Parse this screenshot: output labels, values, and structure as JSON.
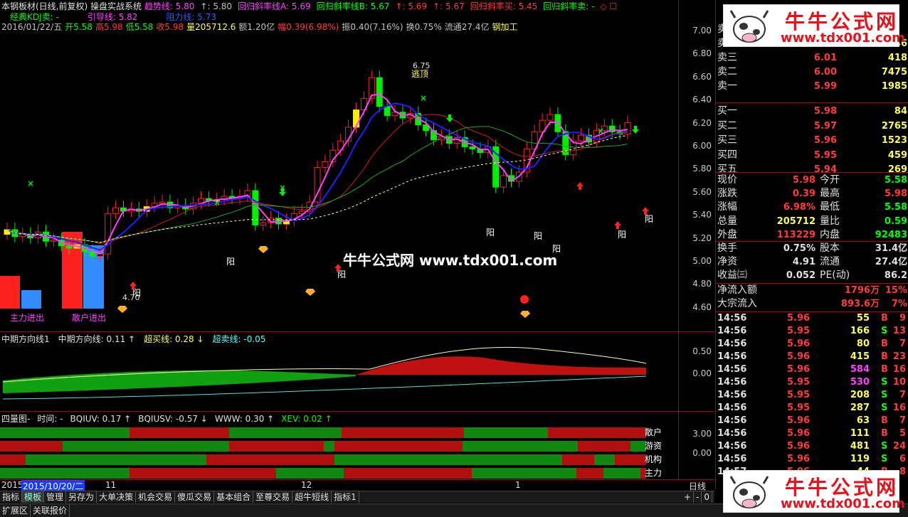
{
  "header": {
    "title": "本钢板材(日线,前复权) 操盘实战系统",
    "items": [
      {
        "label": "趋势线: 5.80",
        "color": "#ff40ff"
      },
      {
        "label": "↑: 5.80",
        "color": "#c0c0c0"
      },
      {
        "label": "回归斜率线A: 5.69",
        "color": "#ff40ff"
      },
      {
        "label": "回归斜率线B: 5.67",
        "color": "#00ff00"
      },
      {
        "label": "↑: 5.69",
        "color": "#ff3b3b"
      },
      {
        "label": "↑: 5.67",
        "color": "#ff3b3b"
      },
      {
        "label": "回归斜率买: 5.45",
        "color": "#ff3b3b"
      },
      {
        "label": "回归斜率卖: -",
        "color": "#00ff00"
      },
      {
        "label": "◇ ☐",
        "color": "#ff3b3b"
      }
    ],
    "line2": [
      {
        "label": "经典KDJ卖: -",
        "color": "#00ff00"
      },
      {
        "label": "引导线: 5.82",
        "color": "#ff40ff"
      },
      {
        "label": "阻力线: 5.73",
        "color": "#2c5cff"
      }
    ],
    "line3": [
      {
        "label": "2016/01/22/五",
        "color": "#c0c0c0"
      },
      {
        "label": "开5.58",
        "color": "#00ff00"
      },
      {
        "label": "高5.98",
        "color": "#ff3b3b"
      },
      {
        "label": "低5.58",
        "color": "#00ff00"
      },
      {
        "label": "收5.98",
        "color": "#ff3b3b"
      },
      {
        "label": "量205712.6",
        "color": "#ffff55"
      },
      {
        "label": "额1.20亿",
        "color": "#c0c0c0"
      },
      {
        "label": "幅0.39(6.98%)",
        "color": "#ff3b3b"
      },
      {
        "label": "振0.40(7.16%)",
        "color": "#c0c0c0"
      },
      {
        "label": "换0.75%",
        "color": "#c0c0c0"
      },
      {
        "label": "流通27.4亿",
        "color": "#c0c0c0"
      },
      {
        "label": "钢加工",
        "color": "#ffff55"
      }
    ]
  },
  "main_chart": {
    "price_ticks": [
      "7.00",
      "6.80",
      "6.60",
      "6.40",
      "6.20",
      "6.00",
      "5.80",
      "5.60",
      "5.40",
      "5.20",
      "5.00",
      "4.80",
      "4.60"
    ],
    "high_label": "6.75",
    "escape_label": "逃顶",
    "low_label": "4.70",
    "sun_label": "阳",
    "bar_labels": [
      "主力进出",
      "散户进出"
    ],
    "watermark": "牛牛公式网 www.tdx001.com"
  },
  "pane2": {
    "items": [
      {
        "label": "中期方向线1",
        "color": "#e0e0e0"
      },
      {
        "label": "中期方向线: 0.11 ↑",
        "color": "#e0e0e0"
      },
      {
        "label": "超买线: 0.28 ↓",
        "color": "#ffff55"
      },
      {
        "label": "超卖线: -0.05",
        "color": "#55ffff"
      }
    ],
    "ticks": [
      "0.50",
      "0.00"
    ]
  },
  "pane3": {
    "items": [
      {
        "label": "四量图-",
        "color": "#e0e0e0"
      },
      {
        "label": "时间: -",
        "color": "#e0e0e0"
      },
      {
        "label": "BQIUV: 0.17 ↑",
        "color": "#e0e0e0"
      },
      {
        "label": "BQIUSV: -0.57 ↓",
        "color": "#e0e0e0"
      },
      {
        "label": "WWW: 0.30 ↑",
        "color": "#e0e0e0"
      },
      {
        "label": "XEV: 0.02 ↑",
        "color": "#00ff00"
      }
    ],
    "ticks": [
      "3.00",
      "0.00"
    ],
    "row_labels": [
      "散户",
      "游资",
      "机构",
      "主力"
    ]
  },
  "date_axis": {
    "start": "2015",
    "selected": "2015/10/20/二",
    "m11": "11",
    "m12": "12",
    "m1": "1"
  },
  "toolbar": {
    "tabs": [
      "指标",
      "模板",
      "管理",
      "另存为",
      "大单决策",
      "机会交易",
      "傻瓜交易",
      "基本组合",
      "至尊交易",
      "超牛短线",
      "指标1"
    ],
    "right": [
      "日线",
      "+",
      "-",
      "0"
    ]
  },
  "bottom_tabs": [
    "扩展区",
    "关联报价"
  ],
  "brand": {
    "cn": "牛牛公式网",
    "url": "www.tdx001.com"
  },
  "quote": {
    "asks": [
      {
        "label": "卖五",
        "price": "",
        "vol": ""
      },
      {
        "label": "卖四",
        "price": "6.02",
        "vol": "646"
      },
      {
        "label": "卖三",
        "price": "6.01",
        "vol": "418"
      },
      {
        "label": "卖二",
        "price": "6.00",
        "vol": "7475"
      },
      {
        "label": "卖一",
        "price": "5.99",
        "vol": "1985"
      }
    ],
    "bids": [
      {
        "label": "买一",
        "price": "5.98",
        "vol": "84"
      },
      {
        "label": "买二",
        "price": "5.97",
        "vol": "2765"
      },
      {
        "label": "买三",
        "price": "5.96",
        "vol": "1523"
      },
      {
        "label": "买四",
        "price": "5.95",
        "vol": "459"
      },
      {
        "label": "买五",
        "price": "5.94",
        "vol": "269"
      }
    ],
    "stats": [
      {
        "l1": "现价",
        "v1": "5.98",
        "c1": "#ff3b3b",
        "l2": "今开",
        "v2": "5.58",
        "c2": "#00ff00"
      },
      {
        "l1": "涨跌",
        "v1": "0.39",
        "c1": "#ff3b3b",
        "l2": "最高",
        "v2": "5.98",
        "c2": "#ff3b3b"
      },
      {
        "l1": "涨幅",
        "v1": "6.98%",
        "c1": "#ff3b3b",
        "l2": "最低",
        "v2": "5.58",
        "c2": "#00ff00"
      },
      {
        "l1": "总量",
        "v1": "205712",
        "c1": "#ffff55",
        "l2": "量比",
        "v2": "0.59",
        "c2": "#00ff00"
      },
      {
        "l1": "外盘",
        "v1": "113229",
        "c1": "#ff3b3b",
        "l2": "内盘",
        "v2": "92483",
        "c2": "#00ff00"
      }
    ],
    "stats2": [
      {
        "l1": "换手",
        "v1": "0.75%",
        "c1": "#e0e0e0",
        "l2": "股本",
        "v2": "31.4亿",
        "c2": "#e0e0e0"
      },
      {
        "l1": "净资",
        "v1": "4.91",
        "c1": "#e0e0e0",
        "l2": "流通",
        "v2": "27.4亿",
        "c2": "#e0e0e0"
      },
      {
        "l1": "收益㈢",
        "v1": "0.052",
        "c1": "#e0e0e0",
        "l2": "PE(动)",
        "v2": "86.2",
        "c2": "#e0e0e0"
      }
    ],
    "flows": [
      {
        "label": "净流入额",
        "val": "1796万",
        "pct": "15%"
      },
      {
        "label": "大宗流入",
        "val": "893.6万",
        "pct": "7%"
      }
    ],
    "ticks": [
      {
        "time": "14:56",
        "price": "5.96",
        "vol": "55",
        "side": "B",
        "n": "9",
        "vc": "#ffff55"
      },
      {
        "time": "14:56",
        "price": "5.95",
        "vol": "166",
        "side": "S",
        "n": "13",
        "vc": "#ffff55"
      },
      {
        "time": "14:56",
        "price": "5.96",
        "vol": "80",
        "side": "B",
        "n": "7",
        "vc": "#ffff55"
      },
      {
        "time": "14:56",
        "price": "5.96",
        "vol": "415",
        "side": "B",
        "n": "23",
        "vc": "#ffff55"
      },
      {
        "time": "14:56",
        "price": "5.96",
        "vol": "584",
        "side": "B",
        "n": "16",
        "vc": "#ff40ff"
      },
      {
        "time": "14:56",
        "price": "5.95",
        "vol": "530",
        "side": "S",
        "n": "10",
        "vc": "#ff40ff"
      },
      {
        "time": "14:56",
        "price": "5.95",
        "vol": "208",
        "side": "S",
        "n": "7",
        "vc": "#ffff55"
      },
      {
        "time": "14:56",
        "price": "5.95",
        "vol": "287",
        "side": "S",
        "n": "16",
        "vc": "#ffff55"
      },
      {
        "time": "14:56",
        "price": "5.96",
        "vol": "63",
        "side": "B",
        "n": "7",
        "vc": "#ffff55"
      },
      {
        "time": "14:56",
        "price": "5.96",
        "vol": "111",
        "side": "B",
        "n": "5",
        "vc": "#ffff55"
      },
      {
        "time": "14:56",
        "price": "5.96",
        "vol": "481",
        "side": "S",
        "n": "24",
        "vc": "#ffff55"
      },
      {
        "time": "14:56",
        "price": "5.96",
        "vol": "119",
        "side": "S",
        "n": "6",
        "vc": "#ffff55"
      },
      {
        "time": "14:57",
        "price": "5.96",
        "vol": "44",
        "side": "B",
        "n": "8",
        "vc": "#ffff55"
      }
    ]
  }
}
